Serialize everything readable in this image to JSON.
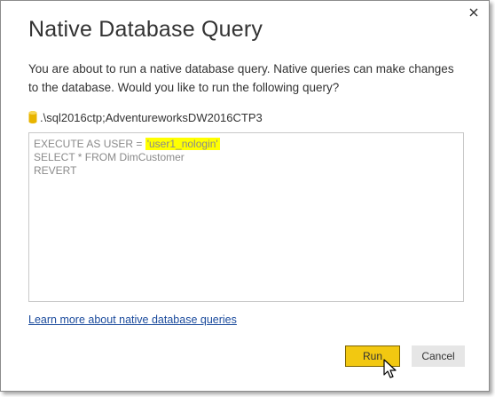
{
  "dialog": {
    "title": "Native Database Query",
    "close_icon": "close-icon",
    "message": "You are about to run a native database query. Native queries can make changes to the database. Would you like to run the following query?",
    "source": {
      "icon": "database-icon",
      "label": ".\\sql2016ctp;AdventureworksDW2016CTP3"
    },
    "query": {
      "line1_prefix": "EXECUTE AS USER = ",
      "line1_highlight": "'user1_nologin'",
      "line2": "SELECT * FROM DimCustomer",
      "line3": "REVERT"
    },
    "learn_more_link": "Learn more about native database queries",
    "buttons": {
      "run_label": "Run",
      "cancel_label": "Cancel"
    }
  },
  "colors": {
    "run_button": "#f2c811",
    "highlight": "#ffff00",
    "link": "#1a4a9c"
  }
}
